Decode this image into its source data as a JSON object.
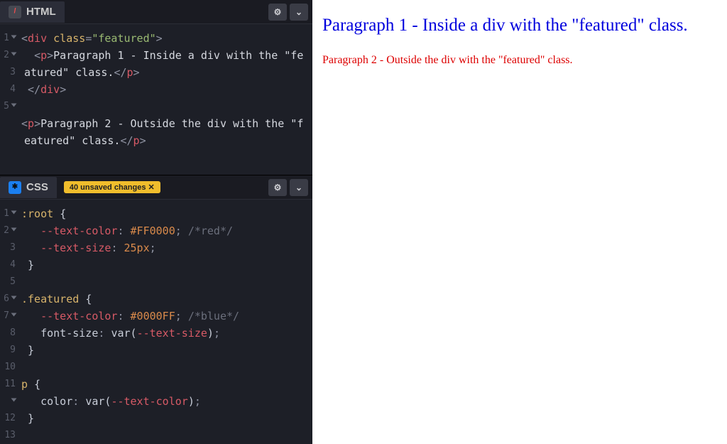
{
  "html_panel": {
    "title": "HTML",
    "code_lines": [
      {
        "n": 1,
        "fold": true,
        "frags": [
          {
            "c": "t-punc",
            "t": "<"
          },
          {
            "c": "t-tag",
            "t": "div"
          },
          {
            "c": "",
            "t": " "
          },
          {
            "c": "t-attr",
            "t": "class"
          },
          {
            "c": "t-punc",
            "t": "="
          },
          {
            "c": "t-str",
            "t": "\"featured\""
          },
          {
            "c": "t-punc",
            "t": ">"
          }
        ]
      },
      {
        "n": 2,
        "fold": true,
        "frags": [
          {
            "c": "",
            "t": "  "
          },
          {
            "c": "t-punc",
            "t": "<"
          },
          {
            "c": "t-tag",
            "t": "p"
          },
          {
            "c": "t-punc",
            "t": ">"
          },
          {
            "c": "",
            "t": "Paragraph 1 - Inside a div with the \"featured\" class."
          },
          {
            "c": "t-punc",
            "t": "</"
          },
          {
            "c": "t-tag",
            "t": "p"
          },
          {
            "c": "t-punc",
            "t": ">"
          }
        ]
      },
      {
        "n": 3,
        "fold": false,
        "frags": [
          {
            "c": "",
            "t": " "
          },
          {
            "c": "t-punc",
            "t": "</"
          },
          {
            "c": "t-tag",
            "t": "div"
          },
          {
            "c": "t-punc",
            "t": ">"
          }
        ]
      },
      {
        "n": 4,
        "fold": false,
        "frags": [
          {
            "c": "",
            "t": ""
          }
        ]
      },
      {
        "n": 5,
        "fold": true,
        "frags": [
          {
            "c": "t-punc",
            "t": "<"
          },
          {
            "c": "t-tag",
            "t": "p"
          },
          {
            "c": "t-punc",
            "t": ">"
          },
          {
            "c": "",
            "t": "Paragraph 2 - Outside the div with the \"featured\" class."
          },
          {
            "c": "t-punc",
            "t": "</"
          },
          {
            "c": "t-tag",
            "t": "p"
          },
          {
            "c": "t-punc",
            "t": ">"
          }
        ]
      }
    ]
  },
  "css_panel": {
    "title": "CSS",
    "badge": "40 unsaved changes",
    "code_lines": [
      {
        "n": 1,
        "fold": true,
        "frags": [
          {
            "c": "t-sel",
            "t": ":root"
          },
          {
            "c": "",
            "t": " "
          },
          {
            "c": "t-brace",
            "t": "{"
          }
        ]
      },
      {
        "n": 2,
        "fold": true,
        "frags": [
          {
            "c": "",
            "t": "   "
          },
          {
            "c": "t-cssvar",
            "t": "--text-color"
          },
          {
            "c": "t-punc",
            "t": ": "
          },
          {
            "c": "t-val",
            "t": "#FF0000"
          },
          {
            "c": "t-punc",
            "t": "; "
          },
          {
            "c": "t-com",
            "t": "/*red*/"
          }
        ]
      },
      {
        "n": 3,
        "fold": false,
        "frags": [
          {
            "c": "",
            "t": "   "
          },
          {
            "c": "t-cssvar",
            "t": "--text-size"
          },
          {
            "c": "t-punc",
            "t": ": "
          },
          {
            "c": "t-val",
            "t": "25px"
          },
          {
            "c": "t-punc",
            "t": ";"
          }
        ]
      },
      {
        "n": 4,
        "fold": false,
        "frags": [
          {
            "c": "",
            "t": " "
          },
          {
            "c": "t-brace",
            "t": "}"
          }
        ]
      },
      {
        "n": 5,
        "fold": false,
        "frags": [
          {
            "c": "",
            "t": ""
          }
        ]
      },
      {
        "n": 6,
        "fold": true,
        "frags": [
          {
            "c": "t-sel",
            "t": ".featured"
          },
          {
            "c": "",
            "t": " "
          },
          {
            "c": "t-brace",
            "t": "{"
          }
        ]
      },
      {
        "n": 7,
        "fold": true,
        "frags": [
          {
            "c": "",
            "t": "   "
          },
          {
            "c": "t-cssvar",
            "t": "--text-color"
          },
          {
            "c": "t-punc",
            "t": ": "
          },
          {
            "c": "t-val",
            "t": "#0000FF"
          },
          {
            "c": "t-punc",
            "t": "; "
          },
          {
            "c": "t-com",
            "t": "/*blue*/"
          }
        ]
      },
      {
        "n": 8,
        "fold": false,
        "frags": [
          {
            "c": "",
            "t": "   "
          },
          {
            "c": "t-prop",
            "t": "font-size"
          },
          {
            "c": "t-punc",
            "t": ": "
          },
          {
            "c": "t-func",
            "t": "var("
          },
          {
            "c": "t-cssvar",
            "t": "--text-size"
          },
          {
            "c": "t-func",
            "t": ")"
          },
          {
            "c": "t-punc",
            "t": ";"
          }
        ]
      },
      {
        "n": 9,
        "fold": false,
        "frags": [
          {
            "c": "",
            "t": " "
          },
          {
            "c": "t-brace",
            "t": "}"
          }
        ]
      },
      {
        "n": 10,
        "fold": false,
        "frags": [
          {
            "c": "",
            "t": ""
          }
        ]
      },
      {
        "n": 11,
        "fold": true,
        "frags": [
          {
            "c": "t-sel",
            "t": "p"
          },
          {
            "c": "",
            "t": " "
          },
          {
            "c": "t-brace",
            "t": "{"
          }
        ]
      },
      {
        "n": 12,
        "fold": false,
        "frags": [
          {
            "c": "",
            "t": "   "
          },
          {
            "c": "t-prop",
            "t": "color"
          },
          {
            "c": "t-punc",
            "t": ": "
          },
          {
            "c": "t-func",
            "t": "var("
          },
          {
            "c": "t-cssvar",
            "t": "--text-color"
          },
          {
            "c": "t-func",
            "t": ")"
          },
          {
            "c": "t-punc",
            "t": ";"
          }
        ]
      },
      {
        "n": 13,
        "fold": false,
        "frags": [
          {
            "c": "",
            "t": " "
          },
          {
            "c": "t-brace",
            "t": "}"
          }
        ]
      }
    ]
  },
  "preview": {
    "p1": "Paragraph 1 - Inside a div with the \"featured\" class.",
    "p2": "Paragraph 2 - Outside the div with the \"featured\" class."
  },
  "colors": {
    "blue": "#0000FF",
    "red": "#FF0000"
  }
}
